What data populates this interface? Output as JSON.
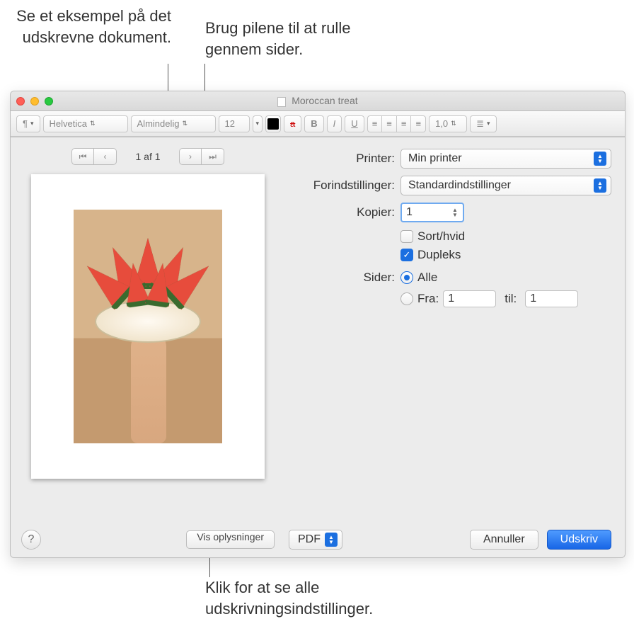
{
  "callouts": {
    "preview": "Se et eksempel på det udskrevne dokument.",
    "arrows": "Brug pilene til at rulle gennem sider.",
    "details": "Klik for at se alle udskrivningsindstillinger."
  },
  "window": {
    "title": "Moroccan treat"
  },
  "toolbar": {
    "font": "Helvetica",
    "style": "Almindelig",
    "size": "12",
    "line_spacing": "1,0"
  },
  "preview": {
    "page_label": "1 af 1"
  },
  "dialog": {
    "labels": {
      "printer": "Printer:",
      "presets": "Forindstillinger:",
      "copies": "Kopier:",
      "pages": "Sider:"
    },
    "printer_value": "Min printer",
    "presets_value": "Standardindstillinger",
    "copies_value": "1",
    "bw_label": "Sort/hvid",
    "duplex_label": "Dupleks",
    "pages_all_label": "Alle",
    "pages_from_label": "Fra:",
    "pages_to_label": "til:",
    "from_value": "1",
    "to_value": "1",
    "details_button": "Vis oplysninger",
    "pdf_button": "PDF",
    "cancel_button": "Annuller",
    "print_button": "Udskriv"
  }
}
